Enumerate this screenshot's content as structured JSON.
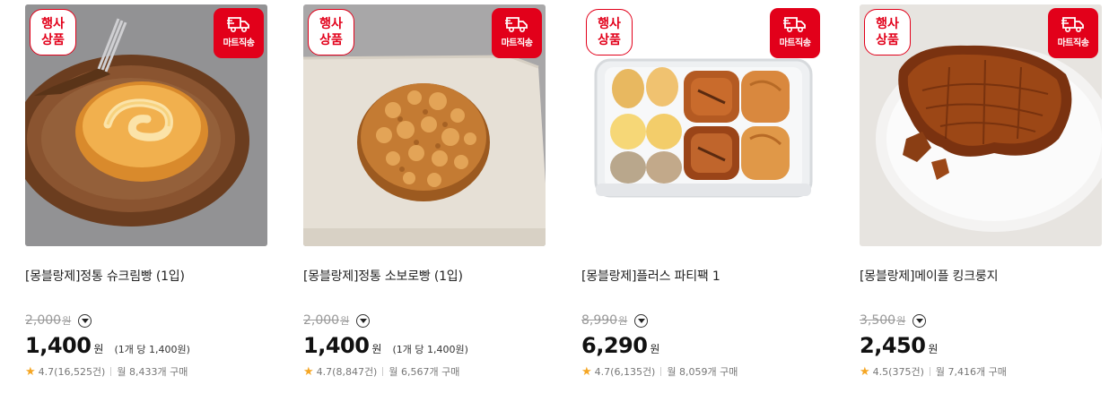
{
  "products": [
    {
      "event_badge": [
        "행사",
        "상품"
      ],
      "delivery_badge": "마트직송",
      "name": "[몽블랑제]정통 슈크림빵 (1입)",
      "original_price": "2,000",
      "original_unit": "원",
      "price": "1,400",
      "currency": "원",
      "unit_price": "(1개 당 1,400원)",
      "rating": "4.7",
      "reviews": "(16,525건)",
      "monthly_sales": "월 8,433개 구매"
    },
    {
      "event_badge": [
        "행사",
        "상품"
      ],
      "delivery_badge": "마트직송",
      "name": "[몽블랑제]정통 소보로빵 (1입)",
      "original_price": "2,000",
      "original_unit": "원",
      "price": "1,400",
      "currency": "원",
      "unit_price": "(1개 당 1,400원)",
      "rating": "4.7",
      "reviews": "(8,847건)",
      "monthly_sales": "월 6,567개 구매"
    },
    {
      "event_badge": [
        "행사",
        "상품"
      ],
      "delivery_badge": "마트직송",
      "name": "[몽블랑제]플러스 파티팩 1",
      "original_price": "8,990",
      "original_unit": "원",
      "price": "6,290",
      "currency": "원",
      "unit_price": "",
      "rating": "4.7",
      "reviews": "(6,135건)",
      "monthly_sales": "월 8,059개 구매"
    },
    {
      "event_badge": [
        "행사",
        "상품"
      ],
      "delivery_badge": "마트직송",
      "name": "[몽블랑제]메이플 킹크룽지",
      "original_price": "3,500",
      "original_unit": "원",
      "price": "2,450",
      "currency": "원",
      "unit_price": "",
      "rating": "4.5",
      "reviews": "(375건)",
      "monthly_sales": "월 7,416개 구매"
    }
  ],
  "colors": {
    "brand_red": "#e2001a",
    "star": "#f5a623",
    "strike_gray": "#999999"
  },
  "icons": {
    "delivery": "delivery-truck-icon",
    "star": "star-icon",
    "toggle": "chevron-down-icon"
  }
}
